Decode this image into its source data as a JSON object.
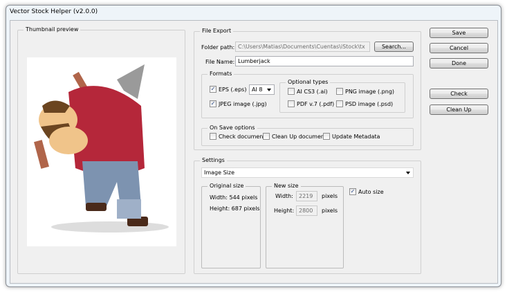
{
  "window": {
    "title": "Vector Stock Helper (v2.0.0)"
  },
  "thumbnail": {
    "legend": "Thumbnail preview"
  },
  "file_export": {
    "legend": "File Export",
    "folder_label": "Folder path:",
    "folder_value": "C:\\Users\\Matias\\Documents\\Cuentas\\iStock\\tx",
    "search_label": "Search...",
    "filename_label": "File Name:",
    "filename_value": "Lumberjack"
  },
  "formats": {
    "legend": "Formats",
    "eps": {
      "label": "EPS (.eps)",
      "checked": true
    },
    "eps_version": "AI 8",
    "jpeg": {
      "label": "JPEG image (.jpg)",
      "checked": true
    },
    "optional": {
      "legend": "Optional types",
      "items": [
        {
          "label": "AI CS3 (.ai)",
          "checked": false
        },
        {
          "label": "PNG image (.png)",
          "checked": false
        },
        {
          "label": "PDF v.7 (.pdf)",
          "checked": false
        },
        {
          "label": "PSD image (.psd)",
          "checked": false
        }
      ]
    }
  },
  "on_save": {
    "legend": "On Save options",
    "items": [
      {
        "label": "Check document",
        "checked": false
      },
      {
        "label": "Clean Up document",
        "checked": false
      },
      {
        "label": "Update Metadata",
        "checked": false
      }
    ]
  },
  "settings": {
    "legend": "Settings",
    "mode": "Image Size",
    "original": {
      "legend": "Original size",
      "width": "Width: 544 pixels",
      "height": "Height: 687 pixels"
    },
    "new": {
      "legend": "New size",
      "width_label": "Width:",
      "width_value": "2219",
      "height_label": "Height:",
      "height_value": "2800",
      "unit": "pixels"
    },
    "auto_size": {
      "label": "Auto size",
      "checked": true
    }
  },
  "buttons": {
    "save": "Save",
    "cancel": "Cancel",
    "done": "Done",
    "check": "Check",
    "cleanup": "Clean Up"
  },
  "check_glyph": "✓"
}
